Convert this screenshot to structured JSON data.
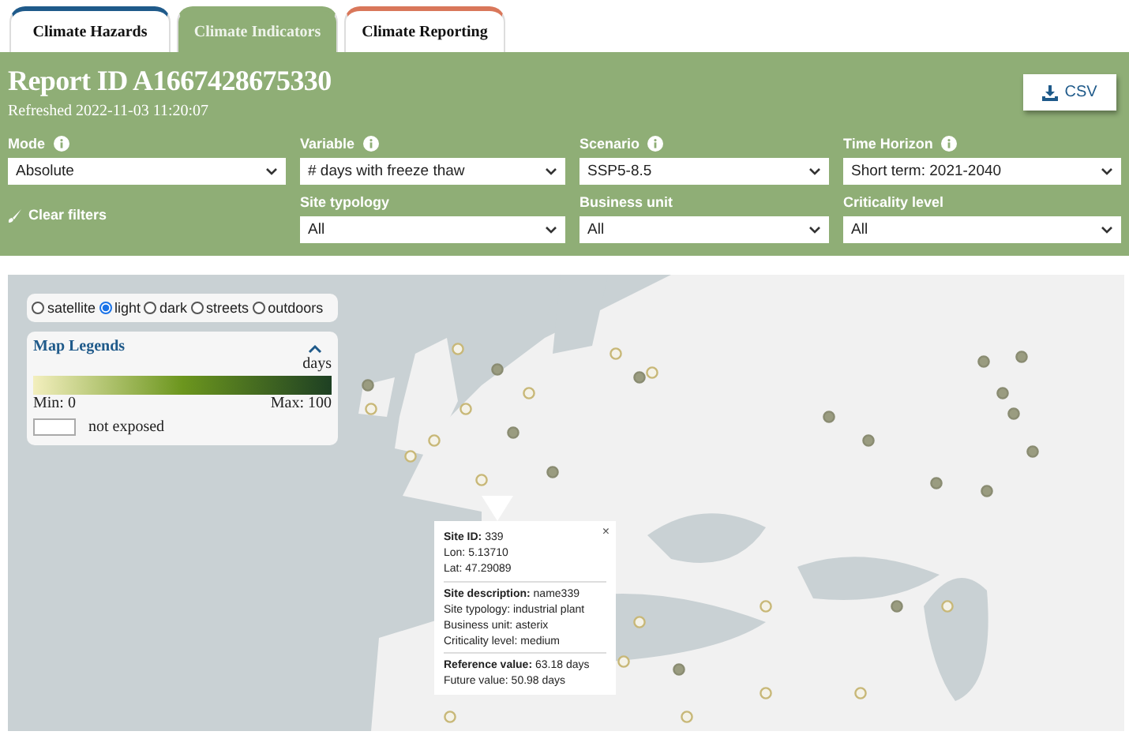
{
  "tabs": [
    {
      "label": "Climate Hazards",
      "selected": false,
      "color": "#1f5a8a"
    },
    {
      "label": "Climate Indicators",
      "selected": true,
      "color": "#8fae76"
    },
    {
      "label": "Climate Reporting",
      "selected": false,
      "color": "#d9775a"
    }
  ],
  "report": {
    "title": "Report ID A1667428675330",
    "refreshed": "Refreshed 2022-11-03 11:20:07",
    "export_button": "CSV"
  },
  "filters": [
    {
      "label": "Mode",
      "info": true,
      "value": "Absolute"
    },
    {
      "label": "Variable",
      "info": true,
      "value": "# days with freeze thaw"
    },
    {
      "label": "Scenario",
      "info": true,
      "value": "SSP5-8.5"
    },
    {
      "label": "Time Horizon",
      "info": true,
      "value": "Short term: 2021-2040"
    },
    {
      "label": "Site typology",
      "info": false,
      "value": "All"
    },
    {
      "label": "Business unit",
      "info": false,
      "value": "All"
    },
    {
      "label": "Criticality level",
      "info": false,
      "value": "All"
    }
  ],
  "clear_filters": "Clear filters",
  "map": {
    "base_layers": [
      {
        "label": "satellite",
        "selected": false
      },
      {
        "label": "light",
        "selected": true
      },
      {
        "label": "dark",
        "selected": false
      },
      {
        "label": "streets",
        "selected": false
      },
      {
        "label": "outdoors",
        "selected": false
      }
    ],
    "legend": {
      "title": "Map Legends",
      "expanded": true,
      "unit": "days",
      "min": "Min: 0",
      "max": "Max: 100",
      "not_exposed": "not exposed"
    },
    "popup": {
      "close": "×",
      "sections": [
        [
          "**Site ID:** 339",
          "Lon: 5.13710",
          "Lat: 47.29089"
        ],
        [
          "**Site description:** name339",
          "Site typology: industrial plant",
          "Business unit: asterix",
          "Criticality level: medium"
        ],
        [
          "**Reference value:** 63.18 days",
          "Future value: 50.98 days"
        ]
      ]
    }
  }
}
